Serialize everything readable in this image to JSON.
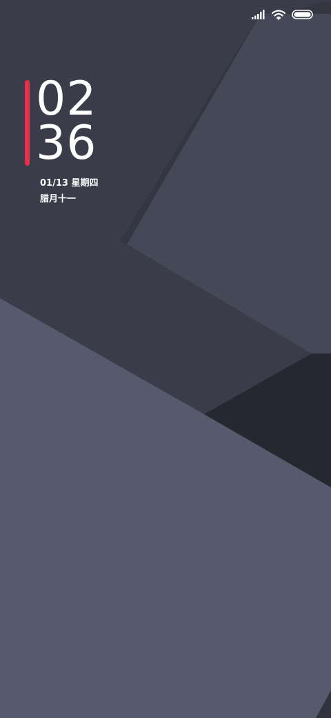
{
  "status_bar": {
    "signal_icon": "cellular-signal-icon",
    "wifi_icon": "wifi-icon",
    "battery_icon": "battery-icon",
    "battery_level": 1.0
  },
  "lock_screen": {
    "clock": {
      "hours": "02",
      "minutes": "36"
    },
    "date_line": "01/13 星期四",
    "lunar_line": "腊月十一",
    "accent_color": "#e8304e"
  },
  "wallpaper": {
    "colors": [
      "#3a3d49",
      "#454957",
      "#555b6d",
      "#252830"
    ]
  }
}
